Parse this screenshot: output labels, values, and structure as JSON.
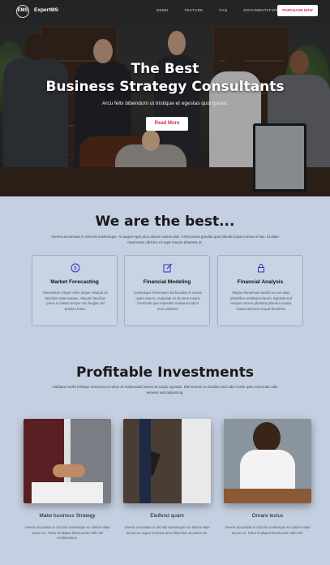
{
  "nav": {
    "logo_text": "EMS",
    "brand": "ExpertMS",
    "menu": [
      "DEMO",
      "FEATURE",
      "FAQ",
      "DOCUMENTATION",
      "SUPPORT"
    ],
    "cta": "PURCHASE NOW"
  },
  "hero": {
    "title_line1": "The Best",
    "title_line2": "Business Strategy Consultants",
    "subtitle": "Arcu felis bibendum ut tristique et egestas quis ipsum.",
    "button": "Read More"
  },
  "features_section": {
    "title": "We are the best...",
    "description": "Viverra accumsan in nisl nisi scelerisque. At augue eget arcu dictum varius duis. Amet purus gravida quis blandit turpis cursus in hac. Id diam maecenas ultricies mi eget mauris pharetra et.",
    "items": [
      {
        "icon": "dollar-coin-icon",
        "title": "Market Forecasting",
        "desc": "Elementum integer enim neque volutpat ac tincidunt vitae semper. Aliquam faucibus purus in massa tempor nec feugiat nisl pretium fusce."
      },
      {
        "icon": "edit-icon",
        "title": "Financial Modeling",
        "desc": "Scelerisque fermentum dui faucibus in ornare quam viverra. Vulputate mi sit amet mauris commodo quis imperdiet massa tincidunt nunc pulvinar."
      },
      {
        "icon": "lock-icon",
        "title": "Financial Analysis",
        "desc": "Magna fermentum iaculis eu non diam phasellus vestibulum lorem. Egestas sed tempus urna et pharetra pharetra massa massa ultricies mi quis hendrerit."
      }
    ]
  },
  "investments_section": {
    "title": "Profitable Investments",
    "description": "Habitant morbi tristique senectus et netus et malesuada fames ac turpis egestas. Elementum eu facilisis sed odio morbi quis commodo odio aenean sed adipiscing.",
    "cards": [
      {
        "title": "Make business Strategy",
        "desc": "Viverra accumsan in nisl nisi scelerisque eu ultrices vitae auctor eu. Tortor id aliquet lectus proin nibh nisl condimentum."
      },
      {
        "title": "Eleifend quam",
        "desc": "Viverra accumsan in nisl nisi scelerisque eu ultrices vitae auctor eu augue ut lectus arcu bibendum at varius vel."
      },
      {
        "title": "Ornare lectus",
        "desc": "Viverra accumsan in nisl nisi scelerisque eu ultrices vitae auctor eu. Tortor id aliquet lectus proin nibh nisl."
      }
    ]
  },
  "colors": {
    "accent": "#e0294a",
    "icon": "#3a2fbf",
    "background": "#c4d0e1"
  }
}
